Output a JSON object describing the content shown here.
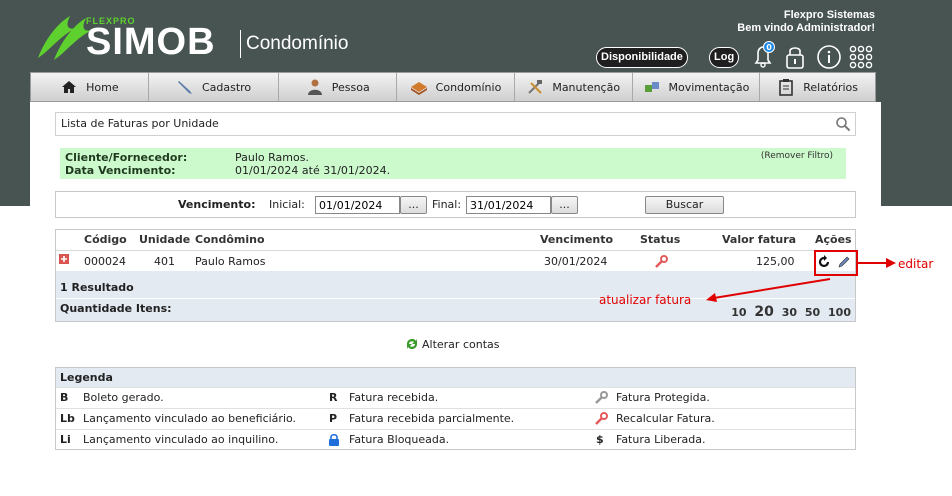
{
  "header": {
    "brand_small": "FLEXPRO",
    "brand_name": "SIMOB",
    "brand_module": "Condomínio",
    "company": "Flexpro Sistemas",
    "welcome": "Bem vindo Administrador!",
    "btn_disponibilidade": "Disponibilidade",
    "btn_log": "Log",
    "notification_count": "0"
  },
  "nav": [
    {
      "label": "Home",
      "icon": "home-icon"
    },
    {
      "label": "Cadastro",
      "icon": "pen-icon"
    },
    {
      "label": "Pessoa",
      "icon": "person-icon"
    },
    {
      "label": "Condomínio",
      "icon": "building-icon"
    },
    {
      "label": "Manutenção",
      "icon": "tools-icon"
    },
    {
      "label": "Movimentação",
      "icon": "transfer-icon"
    },
    {
      "label": "Relatórios",
      "icon": "clipboard-icon"
    }
  ],
  "search": {
    "title": "Lista de Faturas por Unidade"
  },
  "filter": {
    "label_client": "Cliente/Fornecedor:",
    "value_client": "Paulo Ramos.",
    "label_date": "Data Vencimento:",
    "value_date": "01/01/2024 até 31/01/2024.",
    "remove": "(Remover Filtro)"
  },
  "vencimento": {
    "label": "Vencimento:",
    "inicial_label": "Inicial:",
    "inicial_value": "01/01/2024",
    "final_label": "Final:",
    "final_value": "31/01/2024",
    "dots": "...",
    "buscar": "Buscar"
  },
  "table": {
    "headers": {
      "codigo": "Código",
      "unidade": "Unidade",
      "condomino": "Condômino",
      "vencimento": "Vencimento",
      "status": "Status",
      "valor": "Valor fatura",
      "acoes": "Ações"
    },
    "rows": [
      {
        "codigo": "000024",
        "unidade": "401",
        "condomino": "Paulo Ramos",
        "vencimento": "30/01/2024",
        "valor": "125,00"
      }
    ],
    "result_count": "1 Resultado",
    "qty_label": "Quantidade Itens:",
    "page_sizes": [
      "10",
      "20",
      "30",
      "50",
      "100"
    ]
  },
  "alterar_contas": "Alterar contas",
  "legend": {
    "title": "Legenda",
    "col1": [
      {
        "k": "B",
        "v": "Boleto gerado."
      },
      {
        "k": "Lb",
        "v": "Lançamento vinculado ao beneficiário."
      },
      {
        "k": "Li",
        "v": "Lançamento vinculado ao inquilino."
      }
    ],
    "col2": [
      {
        "k": "R",
        "v": "Fatura recebida."
      },
      {
        "k": "P",
        "v": "Fatura recebida parcialmente."
      },
      {
        "k": "",
        "v": "Fatura Bloqueada."
      }
    ],
    "col3": [
      {
        "k": "",
        "v": "Fatura Protegida."
      },
      {
        "k": "",
        "v": "Recalcular Fatura."
      },
      {
        "k": "$",
        "v": "Fatura Liberada."
      }
    ]
  },
  "annotations": {
    "editar": "editar",
    "atualizar": "atualizar fatura"
  },
  "colors": {
    "header_bg": "#475452",
    "accent_green": "#5fd12e",
    "filter_bg": "#ccfacc",
    "annotation_red": "#e00000"
  }
}
